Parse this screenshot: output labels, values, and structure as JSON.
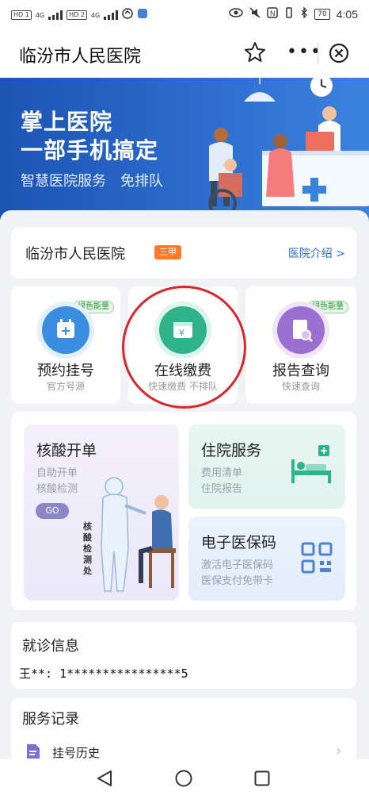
{
  "status": {
    "chip1": "HD 1",
    "net1": "4G",
    "chip2": "HD 2",
    "net2": "4G",
    "battery": "70",
    "time": "4:05"
  },
  "app": {
    "title": "临汾市人民医院"
  },
  "banner": {
    "line1": "掌上医院",
    "line2": "一部手机搞定",
    "tagline": "智慧医院服务　免排队"
  },
  "hospital": {
    "name": "临汾市人民医院",
    "grade": "三甲",
    "intro_link": "医院介绍 >"
  },
  "services": [
    {
      "title": "预约挂号",
      "subtitle": "官方号源",
      "badge": "绿色能量"
    },
    {
      "title": "在线缴费",
      "subtitle": "快速缴费 不排队"
    },
    {
      "title": "报告查询",
      "subtitle": "快速查询",
      "badge": "绿色能量"
    }
  ],
  "nucleic": {
    "title": "核酸开单",
    "line1": "自助开单",
    "line2": "核酸检测",
    "go": "GO",
    "sign": "核酸检测处"
  },
  "inpatient": {
    "title": "住院服务",
    "line1": "费用清单",
    "line2": "住院报告"
  },
  "medical_card": {
    "title": "电子医保码",
    "line1": "激活电子医保码",
    "line2": "医保支付免带卡"
  },
  "visit": {
    "title": "就诊信息",
    "patient": "王**: 1****************5"
  },
  "records": {
    "title": "服务记录",
    "item1": "挂号历史"
  },
  "colors": {
    "primary_blue": "#2a6cd6",
    "grade_orange": "#ff7a2a",
    "highlight_red": "#d9252a",
    "green_badge": "#2a9a3a"
  }
}
